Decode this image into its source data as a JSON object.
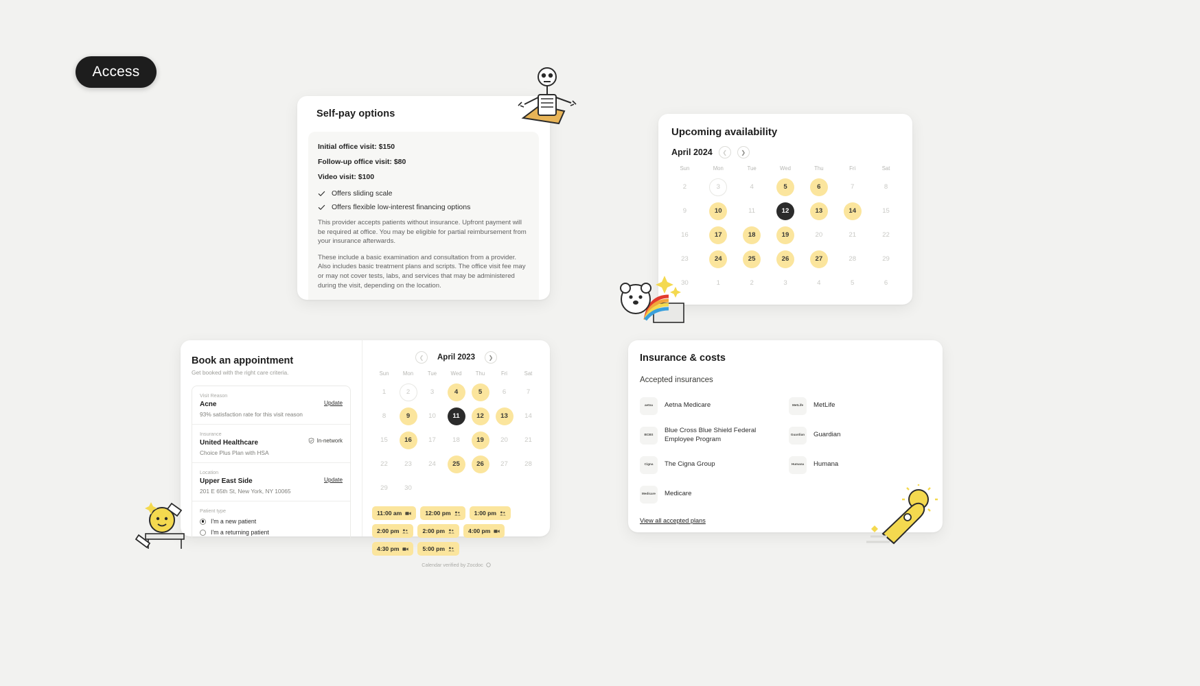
{
  "brand": {
    "pill_label": "Access"
  },
  "self_pay": {
    "title": "Self-pay options",
    "prices": [
      "Initial office visit: $150",
      "Follow-up office visit: $80",
      "Video visit: $100"
    ],
    "features": [
      "Offers sliding scale",
      "Offers flexible low-interest financing options"
    ],
    "paragraphs": [
      "This provider accepts patients without insurance. Upfront payment will be required at office. You may be eligible for partial reimbursement from your insurance afterwards.",
      "These include a basic examination and consultation from a provider. Also includes basic treatment plans and scripts. The office visit fee may or may not cover tests, labs, and services that may be administered during the visit, depending on the location."
    ]
  },
  "availability": {
    "title": "Upcoming availability",
    "month_label": "April 2024",
    "prev_icon": "chevron-left-icon",
    "next_icon": "chevron-right-icon",
    "weekdays": [
      "Sun",
      "Mon",
      "Tue",
      "Wed",
      "Thu",
      "Fri",
      "Sat"
    ],
    "weeks": [
      [
        {
          "n": "2",
          "state": "off"
        },
        {
          "n": "3",
          "state": "today"
        },
        {
          "n": "4",
          "state": "off"
        },
        {
          "n": "5",
          "state": "avail"
        },
        {
          "n": "6",
          "state": "avail"
        },
        {
          "n": "7",
          "state": "off"
        },
        {
          "n": "8",
          "state": "off"
        }
      ],
      [
        {
          "n": "9",
          "state": "off"
        },
        {
          "n": "10",
          "state": "avail"
        },
        {
          "n": "11",
          "state": "off"
        },
        {
          "n": "12",
          "state": "sel"
        },
        {
          "n": "13",
          "state": "avail"
        },
        {
          "n": "14",
          "state": "avail"
        },
        {
          "n": "15",
          "state": "off"
        }
      ],
      [
        {
          "n": "16",
          "state": "off"
        },
        {
          "n": "17",
          "state": "avail"
        },
        {
          "n": "18",
          "state": "avail"
        },
        {
          "n": "19",
          "state": "avail"
        },
        {
          "n": "20",
          "state": "off"
        },
        {
          "n": "21",
          "state": "off"
        },
        {
          "n": "22",
          "state": "off"
        }
      ],
      [
        {
          "n": "23",
          "state": "off"
        },
        {
          "n": "24",
          "state": "avail"
        },
        {
          "n": "25",
          "state": "avail"
        },
        {
          "n": "26",
          "state": "avail"
        },
        {
          "n": "27",
          "state": "avail"
        },
        {
          "n": "28",
          "state": "off"
        },
        {
          "n": "29",
          "state": "off"
        }
      ],
      [
        {
          "n": "30",
          "state": "off"
        },
        {
          "n": "1",
          "state": "off"
        },
        {
          "n": "2",
          "state": "off"
        },
        {
          "n": "3",
          "state": "off"
        },
        {
          "n": "4",
          "state": "off"
        },
        {
          "n": "5",
          "state": "off"
        },
        {
          "n": "6",
          "state": "off"
        }
      ]
    ]
  },
  "book": {
    "title": "Book an appointment",
    "subtitle": "Get booked with the right care criteria.",
    "fields": [
      {
        "label": "Visit Reason",
        "value": "Acne",
        "note": "93% satisfaction rate for this visit reason",
        "action": "Update",
        "badge": null
      },
      {
        "label": "Insurance",
        "value": "United Healthcare",
        "note": "Choice Plus Plan with HSA",
        "action": null,
        "badge": "In-network"
      },
      {
        "label": "Location",
        "value": "Upper East Side",
        "note": "201 E 65th St, New York, NY 10065",
        "action": "Update",
        "badge": null
      }
    ],
    "patient_type": {
      "label": "Patient type",
      "options": [
        {
          "label": "I'm a new patient",
          "selected": true
        },
        {
          "label": "I'm a returning patient",
          "selected": false
        }
      ]
    },
    "calendar": {
      "month_label": "April 2023",
      "weekdays": [
        "Sun",
        "Mon",
        "Tue",
        "Wed",
        "Thu",
        "Fri",
        "Sat"
      ],
      "weeks": [
        [
          {
            "n": "1",
            "state": "off"
          },
          {
            "n": "2",
            "state": "today"
          },
          {
            "n": "3",
            "state": "off"
          },
          {
            "n": "4",
            "state": "avail"
          },
          {
            "n": "5",
            "state": "avail"
          },
          {
            "n": "6",
            "state": "off"
          },
          {
            "n": "7",
            "state": "off"
          }
        ],
        [
          {
            "n": "8",
            "state": "off"
          },
          {
            "n": "9",
            "state": "avail"
          },
          {
            "n": "10",
            "state": "off"
          },
          {
            "n": "11",
            "state": "sel"
          },
          {
            "n": "12",
            "state": "avail"
          },
          {
            "n": "13",
            "state": "avail"
          },
          {
            "n": "14",
            "state": "off"
          }
        ],
        [
          {
            "n": "15",
            "state": "off"
          },
          {
            "n": "16",
            "state": "avail"
          },
          {
            "n": "17",
            "state": "off"
          },
          {
            "n": "18",
            "state": "off"
          },
          {
            "n": "19",
            "state": "avail"
          },
          {
            "n": "20",
            "state": "off"
          },
          {
            "n": "21",
            "state": "off"
          }
        ],
        [
          {
            "n": "22",
            "state": "off"
          },
          {
            "n": "23",
            "state": "off"
          },
          {
            "n": "24",
            "state": "off"
          },
          {
            "n": "25",
            "state": "avail"
          },
          {
            "n": "26",
            "state": "avail"
          },
          {
            "n": "27",
            "state": "off"
          },
          {
            "n": "28",
            "state": "off"
          }
        ],
        [
          {
            "n": "29",
            "state": "off"
          },
          {
            "n": "30",
            "state": "off"
          },
          {
            "n": "",
            "state": "empty"
          },
          {
            "n": "",
            "state": "empty"
          },
          {
            "n": "",
            "state": "empty"
          },
          {
            "n": "",
            "state": "empty"
          },
          {
            "n": "",
            "state": "empty"
          }
        ]
      ]
    },
    "slots": [
      {
        "time": "11:00 am",
        "mode": "video"
      },
      {
        "time": "12:00 pm",
        "mode": "in-person"
      },
      {
        "time": "1:00 pm",
        "mode": "in-person"
      },
      {
        "time": "2:00 pm",
        "mode": "in-person"
      },
      {
        "time": "2:00 pm",
        "mode": "in-person"
      },
      {
        "time": "4:00 pm",
        "mode": "video"
      },
      {
        "time": "4:30 pm",
        "mode": "video"
      },
      {
        "time": "5:00 pm",
        "mode": "in-person"
      }
    ],
    "verified_text": "Calendar verified by Zocdoc"
  },
  "insurance": {
    "title": "Insurance & costs",
    "section_label": "Accepted insurances",
    "items": [
      {
        "logo_text": "aetna",
        "name": "Aetna Medicare"
      },
      {
        "logo_text": "MetLife",
        "name": "MetLife"
      },
      {
        "logo_text": "BCBS",
        "name": "Blue Cross Blue Shield Federal Employee Program"
      },
      {
        "logo_text": "Guardian",
        "name": "Guardian"
      },
      {
        "logo_text": "Cigna",
        "name": "The Cigna Group"
      },
      {
        "logo_text": "Humana",
        "name": "Humana"
      },
      {
        "logo_text": "Medicare",
        "name": "Medicare"
      }
    ],
    "view_all_label": "View all accepted plans"
  },
  "colors": {
    "page_bg": "#f2f2f0",
    "accent_yellow": "#fbe59d",
    "selected_dark": "#2b2b2b",
    "pill_dark": "#1d1d1d"
  }
}
